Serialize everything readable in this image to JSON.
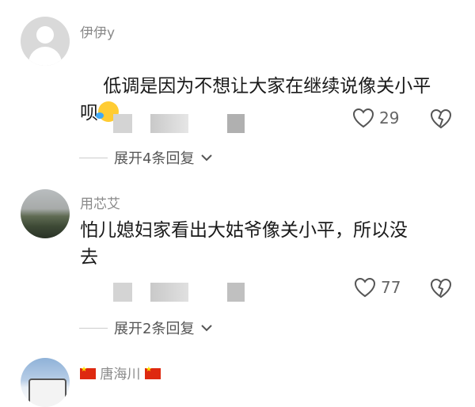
{
  "comments": [
    {
      "username": "伊伊y",
      "text": "低调是因为不想让大家在继续说像关小平\n呗",
      "emoji": "laughing-tears",
      "likes": "29",
      "replies_label": "展开4条回复"
    },
    {
      "username": "用芯艾",
      "text": "怕儿媳妇家看出大姑爷像关小平，所以没\n去",
      "likes": "77",
      "replies_label": "展开2条回复"
    },
    {
      "username": "唐海川",
      "flags": [
        "china-flag",
        "china-flag"
      ]
    }
  ],
  "icons": {
    "like": "heart-outline-icon",
    "dislike": "broken-heart-icon",
    "expand": "chevron-down-icon"
  },
  "colors": {
    "username": "#8a8a8a",
    "text": "#1a1a1a",
    "meta": "#666666"
  }
}
